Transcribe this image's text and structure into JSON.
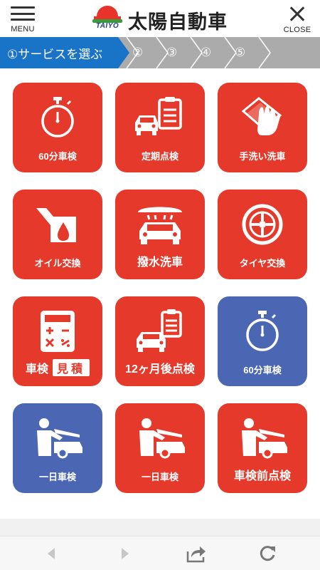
{
  "header": {
    "menu_label": "MENU",
    "logo_text": "TAIYO",
    "brand": "太陽自動車",
    "close_label": "CLOSE"
  },
  "steps": [
    {
      "label": "①サービスを選ぶ",
      "active": true
    },
    {
      "label": "②",
      "active": false
    },
    {
      "label": "③",
      "active": false
    },
    {
      "label": "④",
      "active": false
    },
    {
      "label": "⑤",
      "active": false
    }
  ],
  "services": [
    {
      "label": "60分車検",
      "color": "#e53a2b",
      "icon": "stopwatch-icon"
    },
    {
      "label": "定期点検",
      "color": "#e53a2b",
      "icon": "car-checklist-icon"
    },
    {
      "label": "手洗い洗車",
      "color": "#e53a2b",
      "icon": "glove-cloth-icon"
    },
    {
      "label": "オイル交換",
      "color": "#e53a2b",
      "icon": "oil-drop-icon"
    },
    {
      "label": "撥水洗車",
      "color": "#e53a2b",
      "icon": "car-wash-icon"
    },
    {
      "label": "タイヤ交換",
      "color": "#e53a2b",
      "icon": "tire-icon"
    },
    {
      "label": "車検",
      "badge": "見積",
      "color": "#e53a2b",
      "icon": "calculator-icon"
    },
    {
      "label": "12ヶ月後点検",
      "color": "#e53a2b",
      "icon": "car-checklist-icon"
    },
    {
      "label": "60分車検",
      "color": "#4b66b3",
      "icon": "stopwatch-icon"
    },
    {
      "label": "一日車検",
      "color": "#4b66b3",
      "icon": "mechanic-car-icon"
    },
    {
      "label": "一日車検",
      "color": "#e53a2b",
      "icon": "mechanic-car-icon"
    },
    {
      "label": "車検前点検",
      "color": "#e53a2b",
      "icon": "mechanic-car-icon"
    }
  ],
  "toolbar": {
    "back": "back-arrow-icon",
    "forward": "forward-arrow-icon",
    "share": "share-icon",
    "reload": "reload-icon"
  },
  "colors": {
    "accent_red": "#e53a2b",
    "accent_blue": "#4b66b3",
    "step_active": "#1973c7",
    "step_inactive": "#ababab"
  }
}
